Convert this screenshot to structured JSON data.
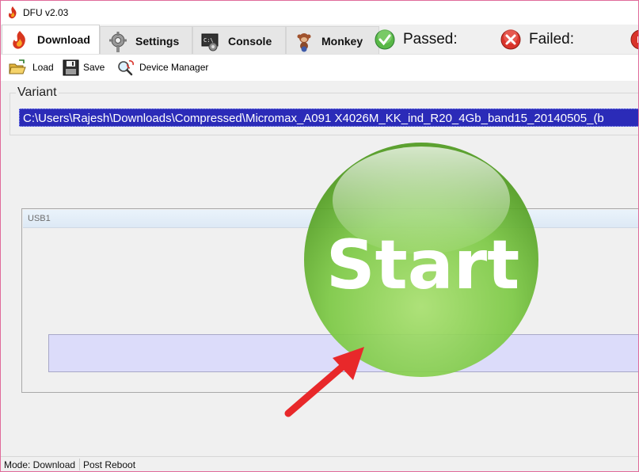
{
  "window": {
    "title": "DFU v2.03"
  },
  "tabs": [
    {
      "label": "Download",
      "icon": "download-flame-icon",
      "active": true
    },
    {
      "label": "Settings",
      "icon": "gear-icon",
      "active": false
    },
    {
      "label": "Console",
      "icon": "console-icon",
      "active": false
    },
    {
      "label": "Monkey",
      "icon": "monkey-icon",
      "active": false
    }
  ],
  "status": {
    "passed_label": "Passed:",
    "failed_label": "Failed:"
  },
  "toolbar": {
    "load_label": "Load",
    "save_label": "Save",
    "device_manager_label": "Device Manager"
  },
  "variant": {
    "legend": "Variant",
    "path": "C:\\Users\\Rajesh\\Downloads\\Compressed\\Micromax_A091 X4026M_KK_ind_R20_4Gb_band15_20140505_(b"
  },
  "usb": {
    "label": "USB1"
  },
  "start_button": {
    "label": "Start"
  },
  "statusbar": {
    "mode": "Mode: Download",
    "post_reboot": "Post Reboot"
  },
  "colors": {
    "variant_highlight": "#2b2bb8",
    "start_green": "#7cc944",
    "arrow_red": "#e8282a",
    "progress_fill": "#dcdcfa"
  }
}
